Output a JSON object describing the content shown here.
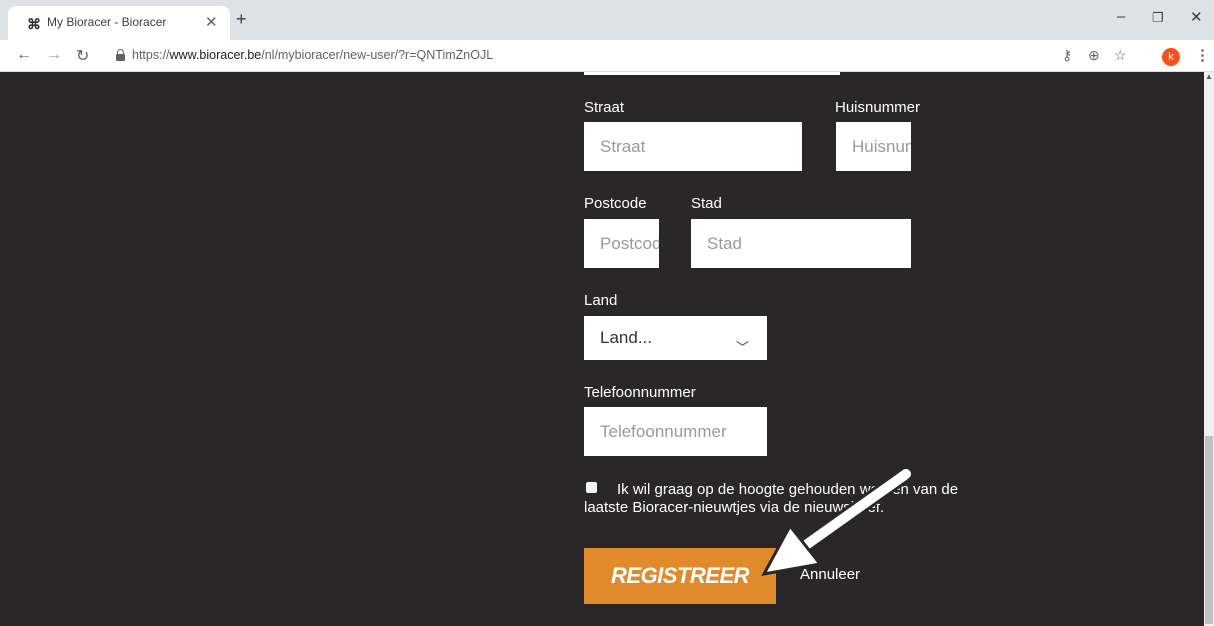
{
  "browser": {
    "tab_title": "My Bioracer - Bioracer",
    "tab_favicon": "bioracer-logo-icon",
    "url_prefix": "https://",
    "url_host": "www.bioracer.be",
    "url_path": "/nl/mybioracer/new-user/?r=QNTimZnOJL",
    "profile_initial": "k"
  },
  "form": {
    "street_label": "Straat",
    "street_placeholder": "Straat",
    "house_label": "Huisnummer",
    "house_placeholder": "Huisnummer",
    "postcode_label": "Postcode",
    "postcode_placeholder": "Postcode",
    "city_label": "Stad",
    "city_placeholder": "Stad",
    "country_label": "Land",
    "country_value": "Land...",
    "phone_label": "Telefoonnummer",
    "phone_placeholder": "Telefoonnummer",
    "newsletter_text": "Ik wil graag op de hoogte gehouden worden van de laatste Bioracer-nieuwtjes via de nieuwsbrief.",
    "register_label": "REGISTREER",
    "cancel_label": "Annuleer"
  },
  "colors": {
    "page_bg": "#2a2728",
    "accent": "#e08a2c"
  }
}
